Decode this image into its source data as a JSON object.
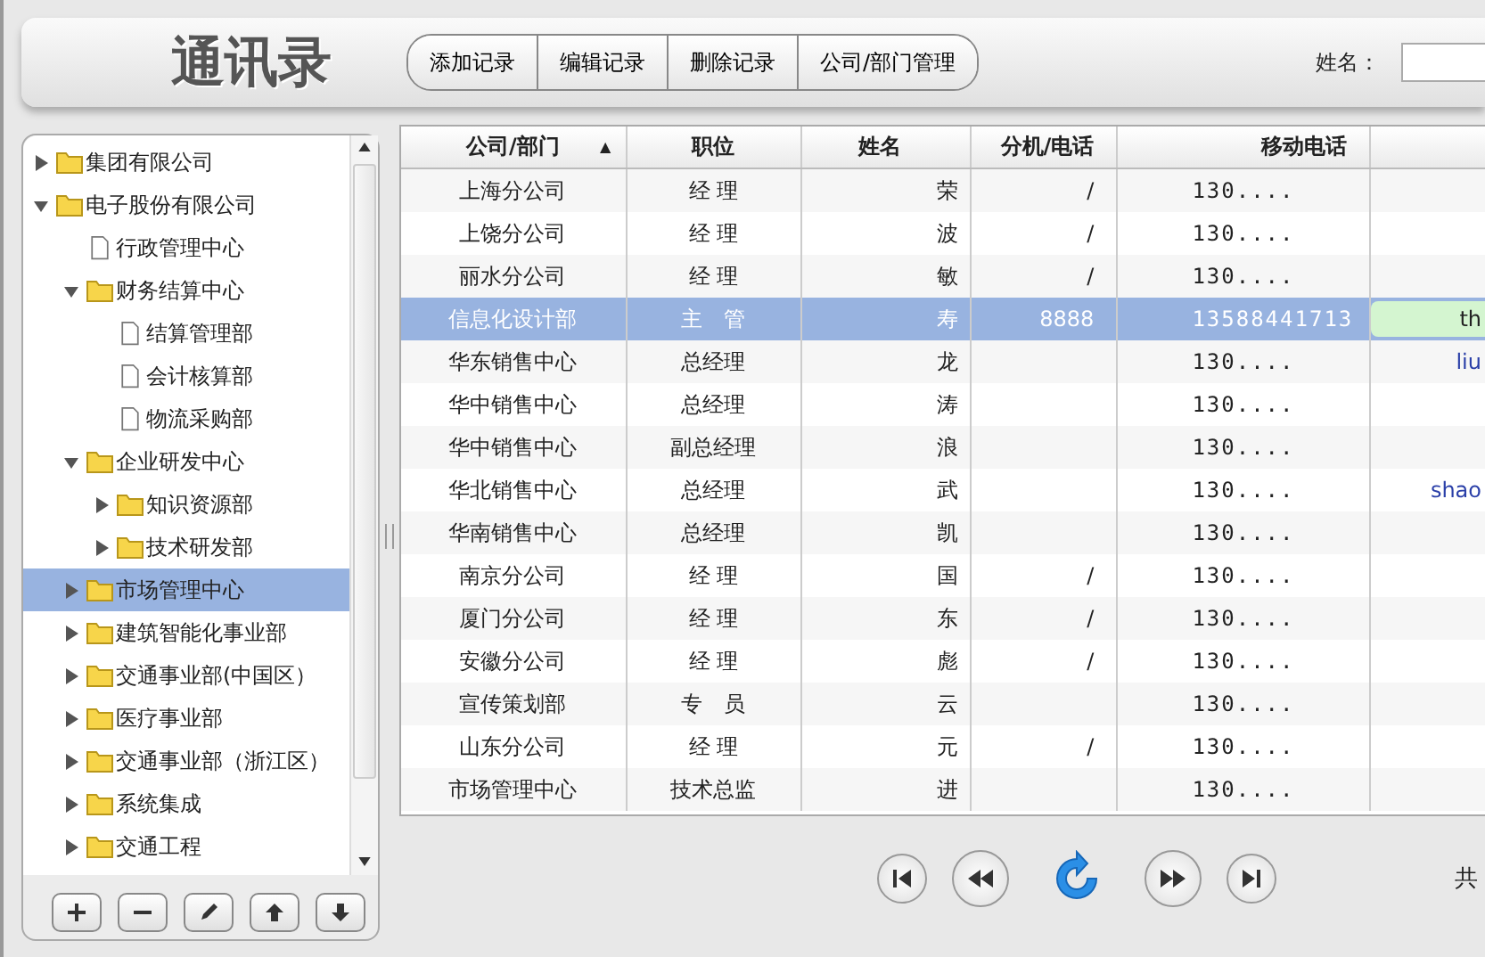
{
  "header": {
    "app_title": "通讯录",
    "toolbar": [
      "添加记录",
      "编辑记录",
      "删除记录",
      "公司/部门管理"
    ],
    "search": {
      "label": "姓名："
    }
  },
  "tree": {
    "items": [
      {
        "label": "集团有限公司",
        "kind": "folder",
        "expanded": false,
        "selected": false
      },
      {
        "label": "电子股份有限公司",
        "kind": "folder",
        "expanded": true,
        "selected": false,
        "children": [
          {
            "label": "行政管理中心",
            "kind": "file",
            "selected": false
          },
          {
            "label": "财务结算中心",
            "kind": "folder",
            "expanded": true,
            "selected": false,
            "children": [
              {
                "label": "结算管理部",
                "kind": "file",
                "selected": false
              },
              {
                "label": "会计核算部",
                "kind": "file",
                "selected": false
              },
              {
                "label": "物流采购部",
                "kind": "file",
                "selected": false
              }
            ]
          },
          {
            "label": "企业研发中心",
            "kind": "folder",
            "expanded": true,
            "selected": false,
            "children": [
              {
                "label": "知识资源部",
                "kind": "folder",
                "expanded": false,
                "selected": false
              },
              {
                "label": "技术研发部",
                "kind": "folder",
                "expanded": false,
                "selected": false
              }
            ]
          },
          {
            "label": "市场管理中心",
            "kind": "folder",
            "expanded": false,
            "selected": true
          },
          {
            "label": "建筑智能化事业部",
            "kind": "folder",
            "expanded": false,
            "selected": false
          },
          {
            "label": "交通事业部(中国区）",
            "kind": "folder",
            "expanded": false,
            "selected": false
          },
          {
            "label": "医疗事业部",
            "kind": "folder",
            "expanded": false,
            "selected": false
          },
          {
            "label": "交通事业部（浙江区）",
            "kind": "folder",
            "expanded": false,
            "selected": false
          },
          {
            "label": "系统集成",
            "kind": "folder",
            "expanded": false,
            "selected": false
          },
          {
            "label": "交通工程",
            "kind": "folder",
            "expanded": false,
            "selected": false
          }
        ]
      }
    ]
  },
  "table": {
    "columns": [
      {
        "label": "公司/部门",
        "sort_mark": "▲"
      },
      {
        "label": "职位"
      },
      {
        "label": "姓名"
      },
      {
        "label": "分机/电话"
      },
      {
        "label": "移动电话"
      },
      {}
    ],
    "rows": [
      {
        "company": "上海分公司",
        "position": "经 理",
        "name": "荣",
        "ext": "/",
        "mobile": "130....",
        "selected": false
      },
      {
        "company": "上饶分公司",
        "position": "经 理",
        "name": "波",
        "ext": "/",
        "mobile": "130....",
        "selected": false
      },
      {
        "company": "丽水分公司",
        "position": "经 理",
        "name": "敏",
        "ext": "/",
        "mobile": "130....",
        "selected": false
      },
      {
        "company": "信息化设计部",
        "position": "主　管",
        "name": "寿",
        "ext": "8888",
        "mobile": "13588441713",
        "column_6": "th",
        "selected": true
      },
      {
        "company": "华东销售中心",
        "position": "总经理",
        "name": "龙",
        "mobile": "130....",
        "column_6": "liu",
        "selected": false
      },
      {
        "company": "华中销售中心",
        "position": "总经理",
        "name": "涛",
        "mobile": "130....",
        "selected": false
      },
      {
        "company": "华中销售中心",
        "position": "副总经理",
        "name": "浪",
        "mobile": "130....",
        "selected": false
      },
      {
        "company": "华北销售中心",
        "position": "总经理",
        "name": "武",
        "mobile": "130....",
        "column_6": "shao",
        "selected": false
      },
      {
        "company": "华南销售中心",
        "position": "总经理",
        "name": "凯",
        "mobile": "130....",
        "selected": false
      },
      {
        "company": "南京分公司",
        "position": "经 理",
        "name": "国",
        "ext": "/",
        "mobile": "130....",
        "selected": false
      },
      {
        "company": "厦门分公司",
        "position": "经 理",
        "name": "东",
        "ext": "/",
        "mobile": "130....",
        "selected": false
      },
      {
        "company": "安徽分公司",
        "position": "经 理",
        "name": "彪",
        "ext": "/",
        "mobile": "130....",
        "selected": false
      },
      {
        "company": "宣传策划部",
        "position": "专　员",
        "name": "云",
        "mobile": "130....",
        "selected": false
      },
      {
        "company": "山东分公司",
        "position": "经 理",
        "name": "元",
        "ext": "/",
        "mobile": "130....",
        "selected": false
      },
      {
        "company": "市场管理中心",
        "position": "技术总监",
        "name": "进",
        "mobile": "130....",
        "selected": false
      }
    ]
  },
  "pager": {
    "total_label": "共"
  }
}
